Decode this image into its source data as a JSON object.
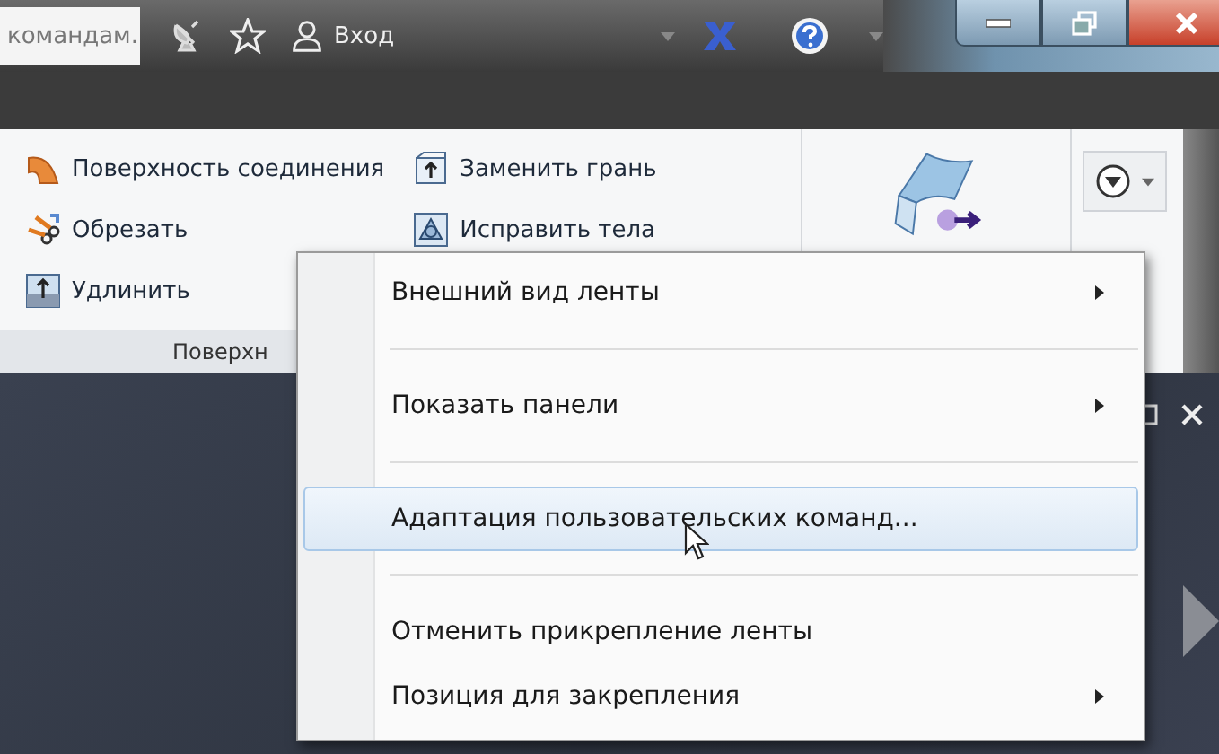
{
  "title_bar": {
    "search": {
      "value": "командам."
    },
    "sign_in": "Вход"
  },
  "ribbon": {
    "left_column": [
      {
        "label": "Поверхность соединения",
        "kind": "surface"
      },
      {
        "label": "Обрезать",
        "kind": "trim"
      },
      {
        "label": "Удлинить",
        "kind": "extend"
      }
    ],
    "right_column": [
      {
        "label": "Заменить грань",
        "kind": "replace"
      },
      {
        "label": "Исправить тела",
        "kind": "repair"
      }
    ],
    "panel_title": "Поверхн"
  },
  "context_menu": {
    "items": [
      {
        "label": "Внешний вид ленты",
        "submenu": true,
        "selected": false,
        "separator_after": true
      },
      {
        "label": "Показать панели",
        "submenu": true,
        "selected": false,
        "separator_after": true
      },
      {
        "label": "Адаптация пользовательских команд...",
        "submenu": false,
        "selected": true,
        "separator_after": true
      },
      {
        "label": "Отменить прикрепление ленты",
        "submenu": false,
        "selected": false,
        "separator_after": false
      },
      {
        "label": "Позиция для закрепления",
        "submenu": true,
        "selected": false,
        "separator_after": false
      }
    ]
  }
}
